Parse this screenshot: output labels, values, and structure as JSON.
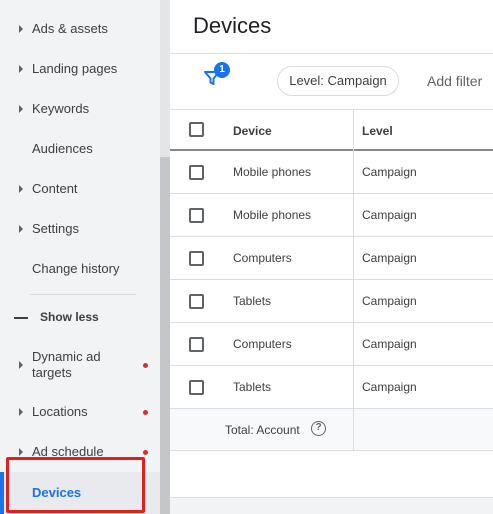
{
  "sidebar": {
    "items": [
      {
        "label": "Ads & assets",
        "caret": true,
        "dot": false
      },
      {
        "label": "Landing pages",
        "caret": true,
        "dot": false
      },
      {
        "label": "Keywords",
        "caret": true,
        "dot": false
      },
      {
        "label": "Audiences",
        "caret": false,
        "dot": false
      },
      {
        "label": "Content",
        "caret": true,
        "dot": false
      },
      {
        "label": "Settings",
        "caret": true,
        "dot": false
      },
      {
        "label": "Change history",
        "caret": false,
        "dot": false
      }
    ],
    "show_less_label": "Show less",
    "extra_items": [
      {
        "label_line1": "Dynamic ad",
        "label_line2": "targets",
        "caret": true,
        "dot": true
      },
      {
        "label": "Locations",
        "caret": true,
        "dot": true
      },
      {
        "label": "Ad schedule",
        "caret": true,
        "dot": true
      }
    ],
    "active_item": "Devices"
  },
  "main": {
    "title": "Devices",
    "toolbar": {
      "filter_count": "1",
      "level_chip": "Level: Campaign",
      "add_filter": "Add filter"
    },
    "table": {
      "columns": [
        "Device",
        "Level"
      ],
      "rows": [
        {
          "device": "Mobile phones",
          "level": "Campaign"
        },
        {
          "device": "Mobile phones",
          "level": "Campaign"
        },
        {
          "device": "Computers",
          "level": "Campaign"
        },
        {
          "device": "Tablets",
          "level": "Campaign"
        },
        {
          "device": "Computers",
          "level": "Campaign"
        },
        {
          "device": "Tablets",
          "level": "Campaign"
        }
      ],
      "total_label": "Total: Account"
    }
  },
  "colors": {
    "accent": "#1a73e8",
    "alert_dot": "#d93025",
    "highlight_box": "#e0201b"
  }
}
